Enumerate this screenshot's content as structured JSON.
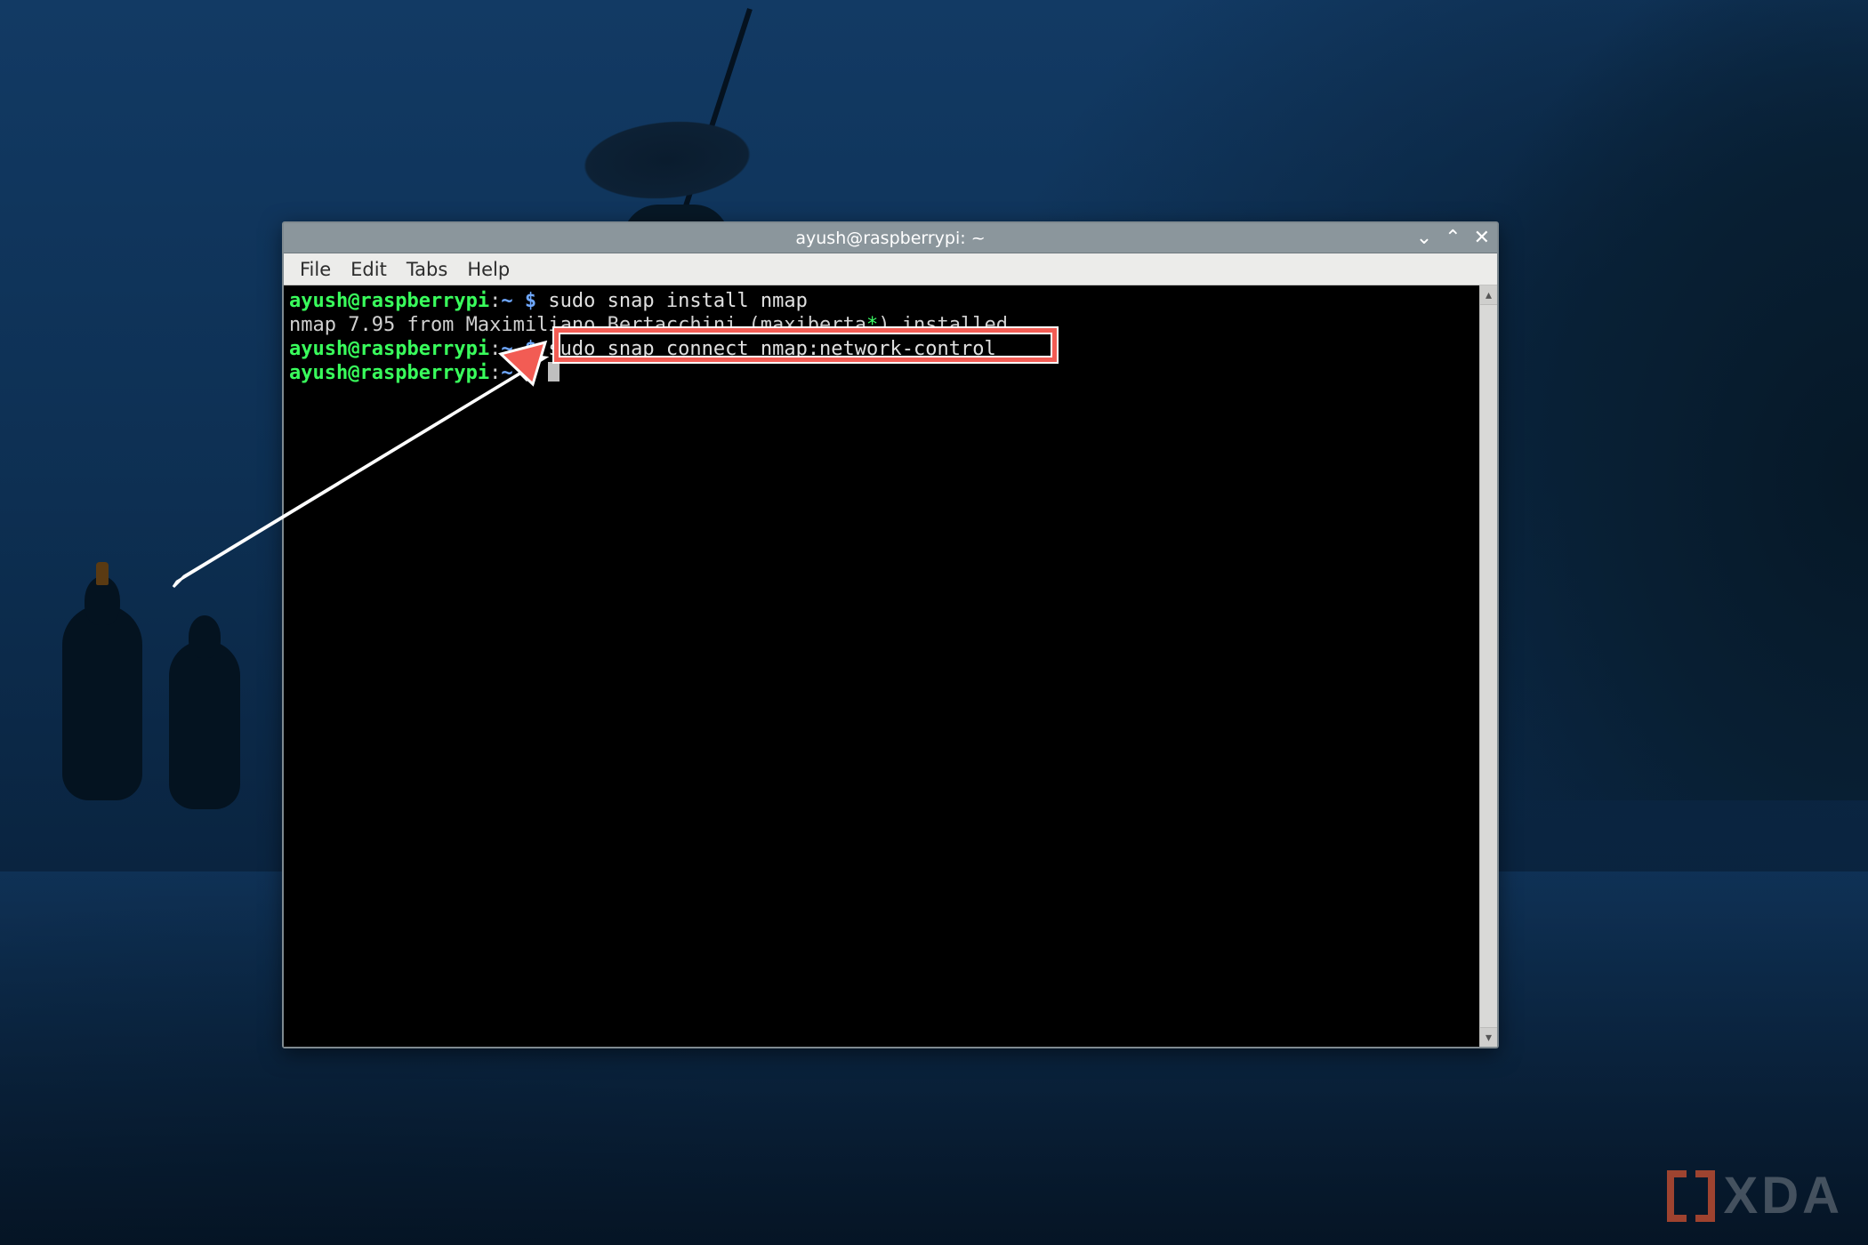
{
  "window": {
    "title": "ayush@raspberrypi: ~",
    "controls": {
      "minimize": "⌄",
      "maximize": "⌃",
      "close": "✕"
    }
  },
  "menubar": [
    "File",
    "Edit",
    "Tabs",
    "Help"
  ],
  "terminal": {
    "prompt_host": "ayush@raspberrypi",
    "prompt_path": "~",
    "prompt_symbol": "$",
    "lines": [
      {
        "type": "prompt",
        "cmd": "sudo snap install nmap"
      },
      {
        "type": "output",
        "text_pre": "nmap 7.95 from Maximiliano Bertacchini (maxiberta",
        "text_star": "*",
        "text_post": ") installed"
      },
      {
        "type": "prompt",
        "cmd": "sudo snap connect nmap:network-control"
      },
      {
        "type": "prompt",
        "cmd": ""
      }
    ]
  },
  "colors": {
    "prompt_host": "#39ff5c",
    "prompt_path": "#6fa8ff",
    "titlebar_bg": "#8b969c",
    "annotation": "#f25c54"
  },
  "annotation": {
    "highlights_command": "sudo snap connect nmap:network-control"
  },
  "watermark": {
    "text": "XDA"
  }
}
